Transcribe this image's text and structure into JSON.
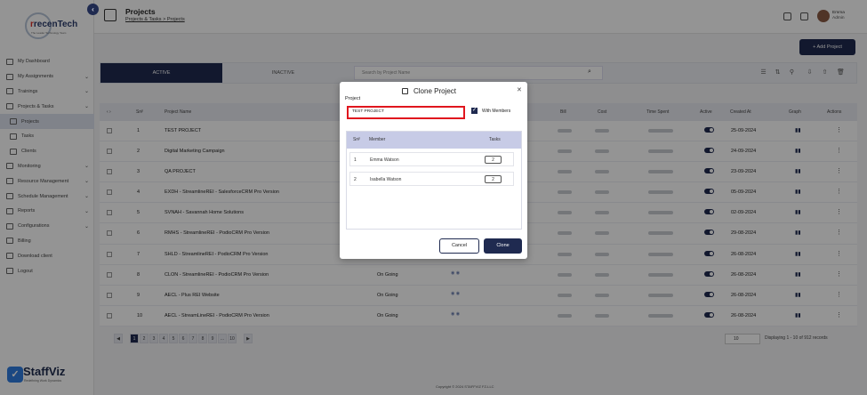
{
  "brand": {
    "logo_text": "recenTech",
    "logo_tagline": "The Leader Technology Team",
    "bottom_logo": "StaffViz",
    "bottom_tagline": "Redefining Work Dynamics"
  },
  "sidebar": {
    "items": [
      {
        "label": "My Dashboard",
        "icon": "dashboard-icon"
      },
      {
        "label": "My Assignments",
        "icon": "assignment-icon"
      },
      {
        "label": "Trainings",
        "icon": "training-icon"
      },
      {
        "label": "Projects & Tasks",
        "icon": "projects-icon"
      },
      {
        "label": "Projects",
        "icon": "project-icon",
        "active": true
      },
      {
        "label": "Tasks",
        "icon": "task-icon"
      },
      {
        "label": "Clients",
        "icon": "clients-icon"
      },
      {
        "label": "Monitoring",
        "icon": "monitoring-icon"
      },
      {
        "label": "Resource Management",
        "icon": "resource-icon"
      },
      {
        "label": "Schedule Management",
        "icon": "schedule-icon"
      },
      {
        "label": "Reports",
        "icon": "reports-icon"
      },
      {
        "label": "Configurations",
        "icon": "config-icon"
      },
      {
        "label": "Billing",
        "icon": "billing-icon"
      },
      {
        "label": "Download client",
        "icon": "download-icon"
      },
      {
        "label": "Logout",
        "icon": "logout-icon"
      }
    ]
  },
  "header": {
    "title": "Projects",
    "breadcrumb": "Projects & Tasks > Projects",
    "user_name": "Emma",
    "user_role": "Admin"
  },
  "main": {
    "add_button": "+ Add Project",
    "tab_active": "ACTIVE",
    "tab_inactive": "INACTIVE",
    "search_placeholder": "Search by Project Name",
    "columns": [
      "Sr#",
      "Project Name",
      "Bill",
      "Cost",
      "Time Spent",
      "Active",
      "Created At",
      "Graph",
      "Actions"
    ],
    "rows": [
      {
        "sr": "1",
        "name": "TEST PROJECT",
        "status": "",
        "date": "25-09-2024"
      },
      {
        "sr": "2",
        "name": "Digital Marketing Campaign",
        "status": "",
        "date": "24-09-2024"
      },
      {
        "sr": "3",
        "name": "QA PROJECT",
        "status": "",
        "date": "23-09-2024"
      },
      {
        "sr": "4",
        "name": "EXDH - StreamlineREI - SalesforceCRM Pro Version",
        "status": "",
        "date": "05-09-2024"
      },
      {
        "sr": "5",
        "name": "SVNAH - Savannah Home Solutions",
        "status": "",
        "date": "02-09-2024"
      },
      {
        "sr": "6",
        "name": "RMHS - StreamlineREI - PodioCRM Pro Version",
        "status": "",
        "date": "29-08-2024"
      },
      {
        "sr": "7",
        "name": "SHLD - StreamlineREI - PodioCRM Pro Version",
        "status": "",
        "date": "26-08-2024"
      },
      {
        "sr": "8",
        "name": "CLON - StreamlineREI - PodioCRM Pro Version",
        "status": "On Going",
        "date": "26-08-2024"
      },
      {
        "sr": "9",
        "name": "AECL - Plus REI Website",
        "status": "On Going",
        "date": "26-08-2024"
      },
      {
        "sr": "10",
        "name": "AECL - StreamLineREI - PodioCRM Pro Version",
        "status": "On Going",
        "date": "26-08-2024"
      }
    ],
    "pages": [
      "1",
      "2",
      "3",
      "4",
      "5",
      "6",
      "7",
      "8",
      "9",
      "...",
      "10"
    ],
    "per_page": "10",
    "display_info": "Displaying 1 - 10 of 912 records",
    "copyright": "Copyright © 2024 STAFFVIZ FZ-LLC"
  },
  "modal": {
    "title": "Clone Project",
    "field_label": "Project",
    "field_value": "TEST PROJECT",
    "with_members_label": "With Members",
    "with_members_checked": true,
    "columns": [
      "Sr#",
      "Member",
      "Tasks"
    ],
    "members": [
      {
        "sr": "1",
        "name": "Emma Watson",
        "tasks": "2"
      },
      {
        "sr": "2",
        "name": "Isabella Watson",
        "tasks": "2"
      }
    ],
    "cancel_label": "Cancel",
    "clone_label": "Clone"
  },
  "colors": {
    "primary": "#1f2a50",
    "highlight": "#e0161e",
    "member_header": "#c7cbe6"
  }
}
